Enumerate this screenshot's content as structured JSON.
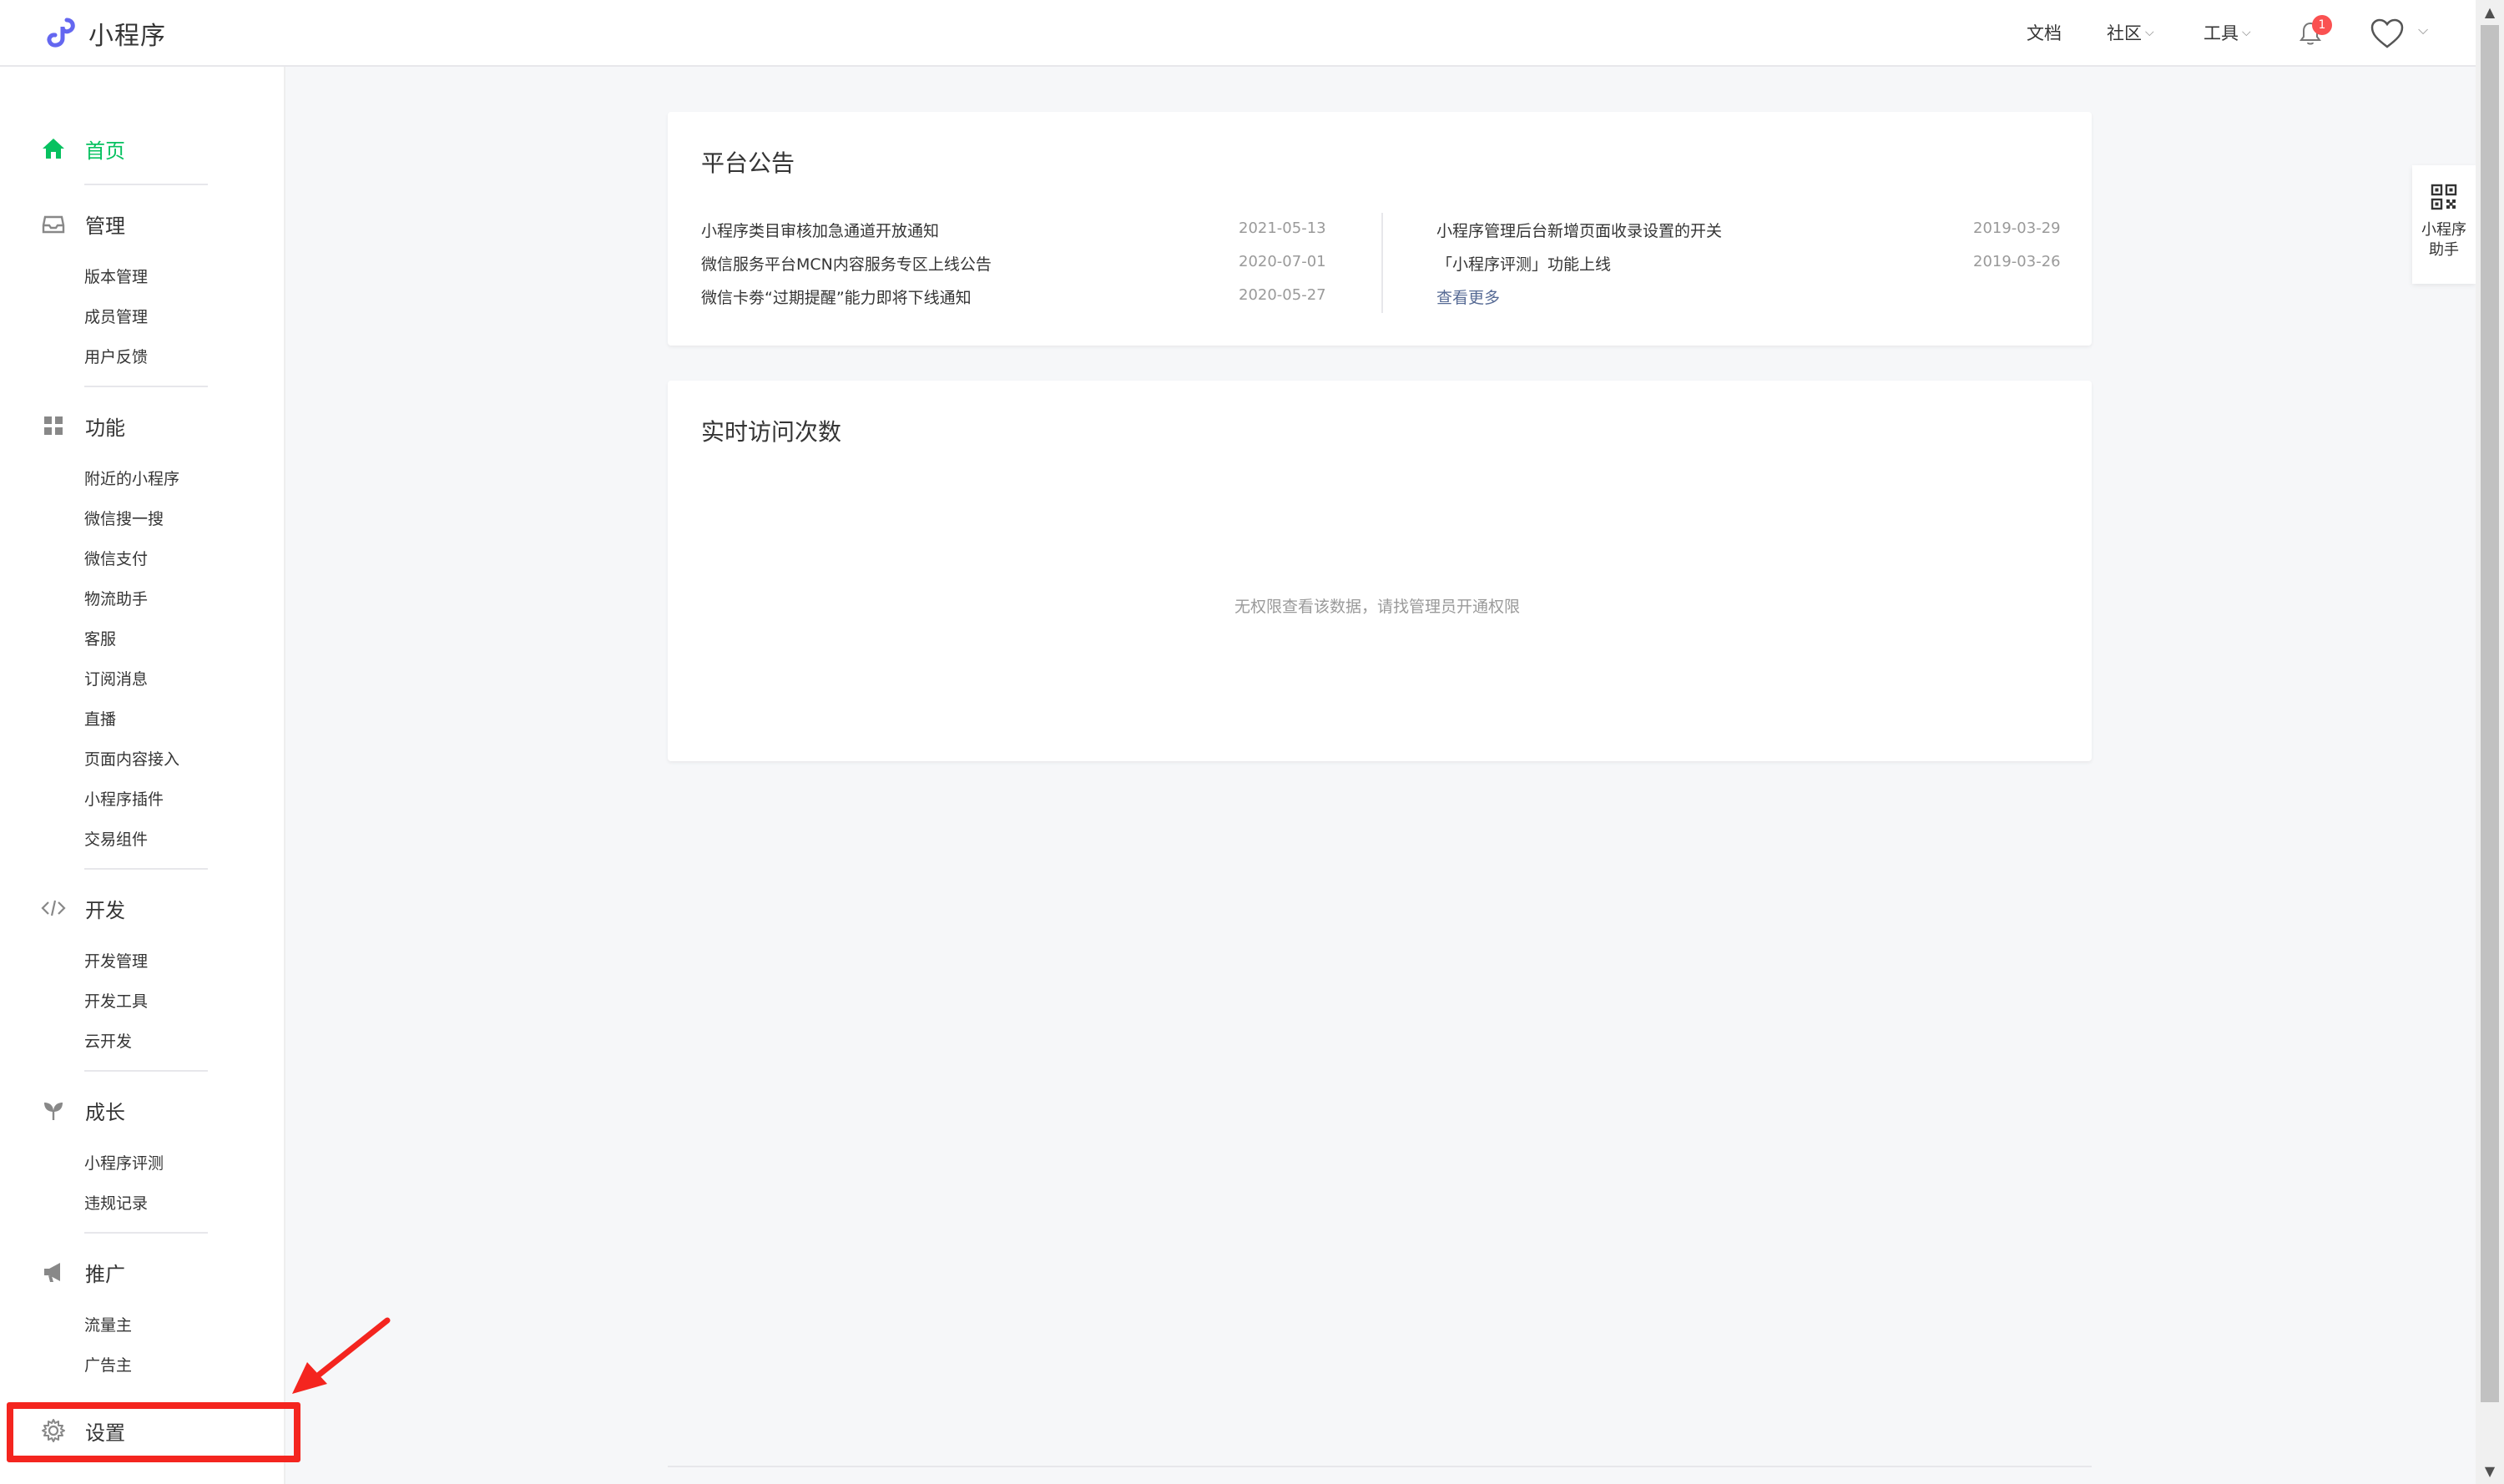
{
  "header": {
    "app_name": "小程序",
    "nav": [
      {
        "label": "文档"
      },
      {
        "label": "社区"
      },
      {
        "label": "工具"
      }
    ],
    "notification_count": "1"
  },
  "sidebar": {
    "sections": [
      {
        "title": "首页",
        "icon": "home-icon",
        "items": []
      },
      {
        "title": "管理",
        "icon": "inbox-icon",
        "items": [
          "版本管理",
          "成员管理",
          "用户反馈"
        ]
      },
      {
        "title": "功能",
        "icon": "grid-icon",
        "items": [
          "附近的小程序",
          "微信搜一搜",
          "微信支付",
          "物流助手",
          "客服",
          "订阅消息",
          "直播",
          "页面内容接入",
          "小程序插件",
          "交易组件"
        ]
      },
      {
        "title": "开发",
        "icon": "code-icon",
        "items": [
          "开发管理",
          "开发工具",
          "云开发"
        ]
      },
      {
        "title": "成长",
        "icon": "sprout-icon",
        "items": [
          "小程序评测",
          "违规记录"
        ]
      },
      {
        "title": "推广",
        "icon": "megaphone-icon",
        "items": [
          "流量主",
          "广告主"
        ]
      },
      {
        "title": "设置",
        "icon": "gear-icon",
        "items": []
      }
    ]
  },
  "announcements": {
    "title": "平台公告",
    "left": [
      {
        "text": "小程序类目审核加急通道开放通知",
        "date": "2021-05-13"
      },
      {
        "text": "微信服务平台MCN内容服务专区上线公告",
        "date": "2020-07-01"
      },
      {
        "text": "微信卡劵“过期提醒”能力即将下线通知",
        "date": "2020-05-27"
      }
    ],
    "right": [
      {
        "text": "小程序管理后台新增页面收录设置的开关",
        "date": "2019-03-29"
      },
      {
        "text": "「小程序评测」功能上线",
        "date": "2019-03-26"
      }
    ],
    "more_label": "查看更多"
  },
  "realtime": {
    "title": "实时访问次数",
    "empty_message": "无权限查看该数据，请找管理员开通权限"
  },
  "helper": {
    "label_line1": "小程序",
    "label_line2": "助手",
    "icon": "qrcode-icon"
  },
  "colors": {
    "accent_green": "#07c160",
    "link_blue": "#576b95",
    "highlight_red": "#f4251f",
    "badge_red": "#fa5151"
  }
}
